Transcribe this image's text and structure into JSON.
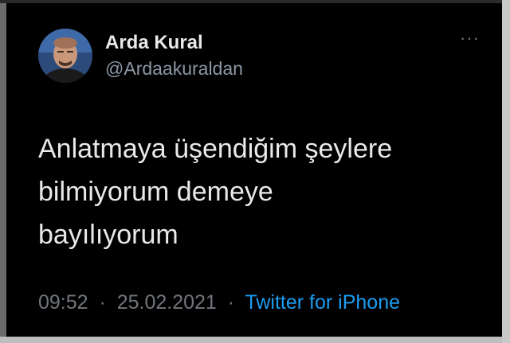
{
  "author": {
    "display_name": "Arda Kural",
    "handle": "@Ardaakuraldan"
  },
  "more_menu": "···",
  "tweet": {
    "lines": [
      "Anlatmaya üşendiğim şeylere",
      "bilmiyorum demeye",
      "bayılıyorum"
    ]
  },
  "meta": {
    "time": "09:52",
    "date": "25.02.2021",
    "source": "Twitter for iPhone",
    "separator": "·"
  },
  "colors": {
    "background": "#000000",
    "text": "#e7e9ea",
    "secondary": "#71767b",
    "link": "#1d9bf0"
  },
  "icons": [
    "avatar",
    "more-icon"
  ]
}
